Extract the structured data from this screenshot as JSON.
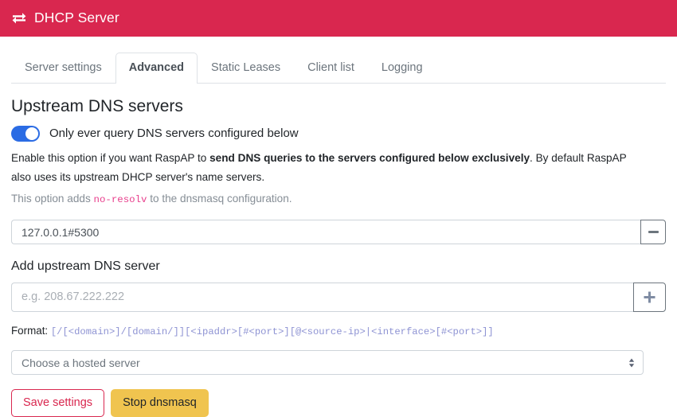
{
  "header": {
    "title": "DHCP Server",
    "icon": "exchange-arrows-icon",
    "background_color": "#d9274f"
  },
  "tabs": [
    {
      "label": "Server settings",
      "active": false
    },
    {
      "label": "Advanced",
      "active": true
    },
    {
      "label": "Static Leases",
      "active": false
    },
    {
      "label": "Client list",
      "active": false
    },
    {
      "label": "Logging",
      "active": false
    }
  ],
  "main": {
    "section_title": "Upstream DNS servers",
    "toggle": {
      "label": "Only ever query DNS servers configured below",
      "state": "on",
      "accent_color": "#2b6ce4"
    },
    "description": {
      "part1": "Enable this option if you want RaspAP to ",
      "strong": "send DNS queries to the servers configured below exclusively",
      "part2": ". By default RaspAP also uses its upstream DHCP server's name servers."
    },
    "note": {
      "prefix": "This option adds ",
      "code": "no-resolv",
      "suffix": " to the dnsmasq configuration."
    },
    "existing_server": {
      "value": "127.0.0.1#5300",
      "remove_icon": "minus-icon"
    },
    "add_server": {
      "label": "Add upstream DNS server",
      "placeholder": "e.g. 208.67.222.222",
      "value": "",
      "add_icon": "plus-icon"
    },
    "format": {
      "label": "Format: ",
      "pattern": "[/[<domain>]/[domain/]][<ipaddr>[#<port>][@<source-ip>|<interface>[#<port>]]"
    },
    "hosted_server_select": {
      "selected": "Choose a hosted server",
      "arrow_icon": "chevron-up-down-icon"
    },
    "buttons": {
      "save": "Save settings",
      "stop": "Stop dnsmasq",
      "save_color": "#d9274f",
      "stop_color": "#f0c44f"
    }
  }
}
